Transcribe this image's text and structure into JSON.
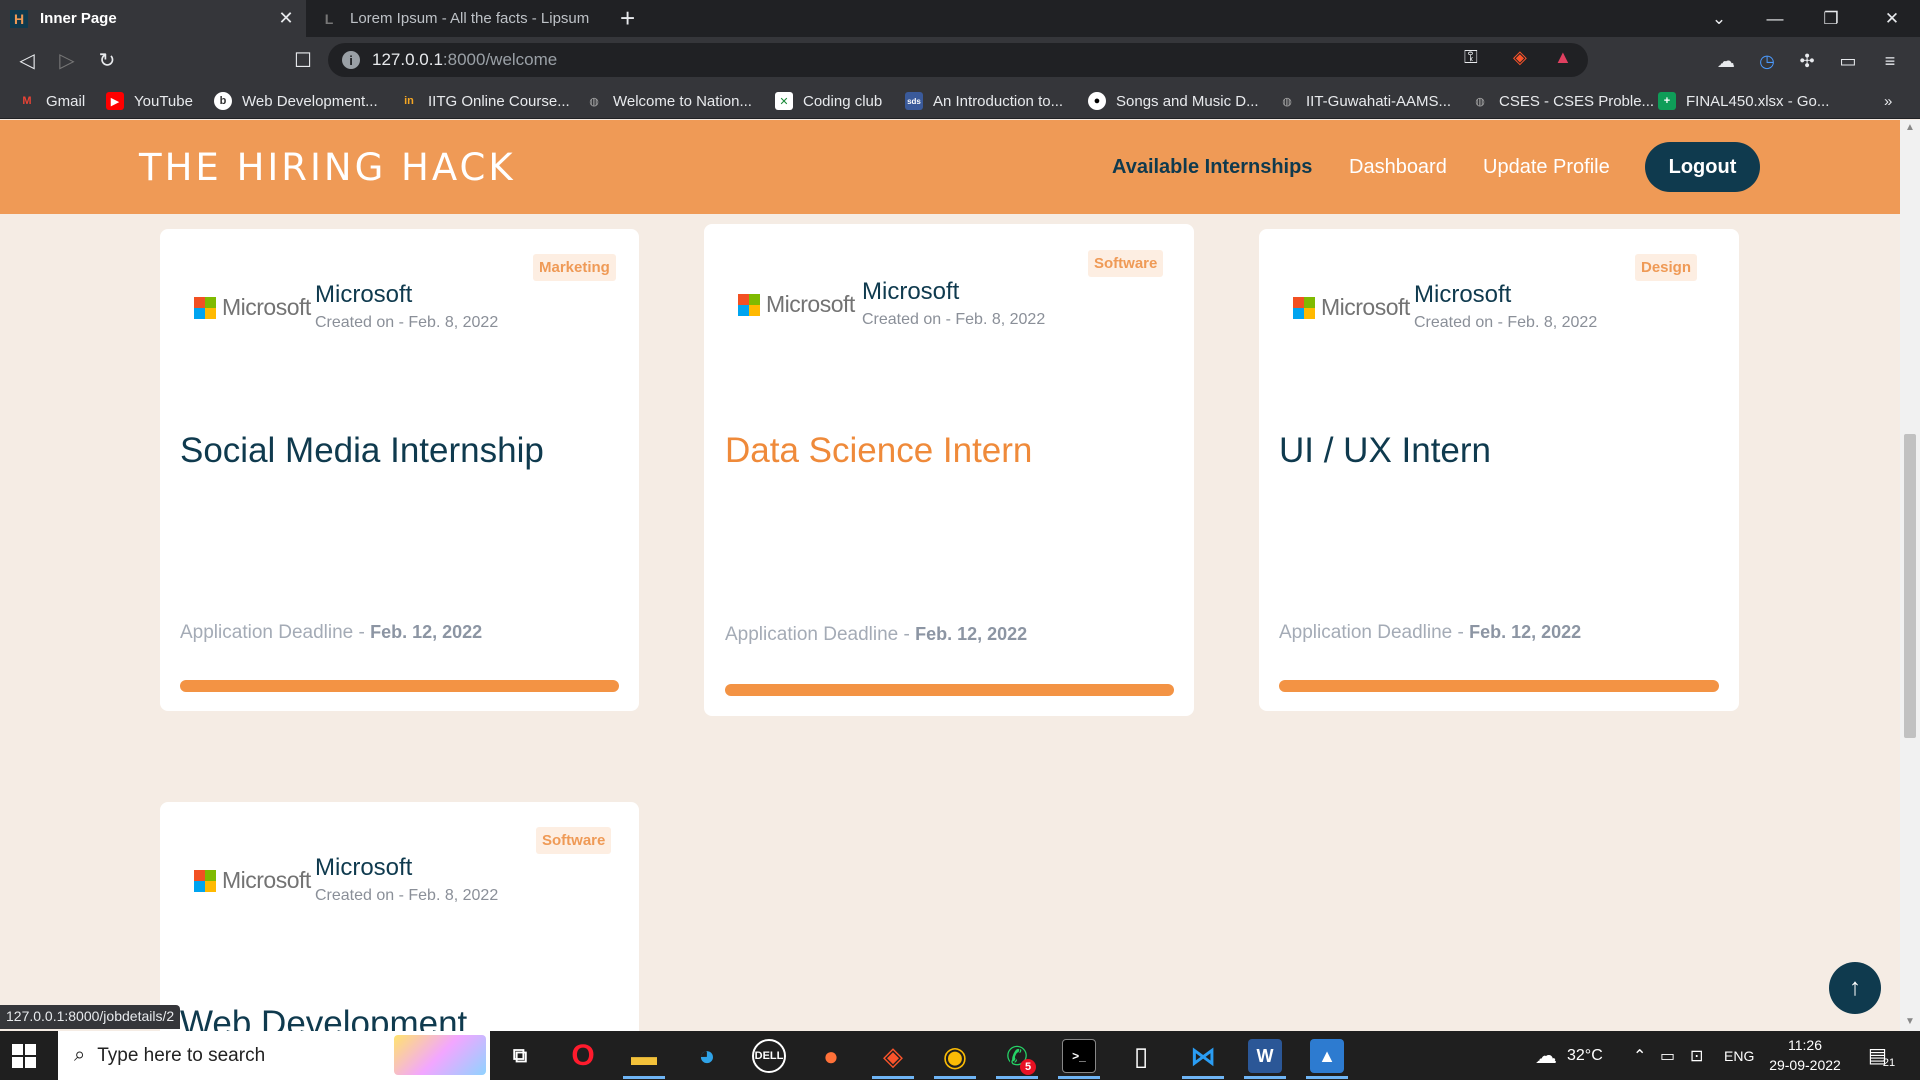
{
  "browser": {
    "tabs": [
      {
        "title": "Inner Page",
        "active": true
      },
      {
        "title": "Lorem Ipsum - All the facts - Lipsum g",
        "active": false
      }
    ],
    "url_host": "127.0.0.1",
    "url_path": ":8000/welcome",
    "bookmarks": [
      {
        "label": "Gmail",
        "icon": "gmail-icon"
      },
      {
        "label": "YouTube",
        "icon": "youtube-icon"
      },
      {
        "label": "Web Development...",
        "icon": "globe-icon"
      },
      {
        "label": "IITG Online Course...",
        "icon": "course-icon"
      },
      {
        "label": "Welcome to Nation...",
        "icon": "globe-icon"
      },
      {
        "label": "Coding club",
        "icon": "coding-club-icon"
      },
      {
        "label": "An Introduction to...",
        "icon": "document-icon"
      },
      {
        "label": "Songs and Music D...",
        "icon": "github-icon"
      },
      {
        "label": "IIT-Guwahati-AAMS...",
        "icon": "globe-icon"
      },
      {
        "label": "CSES - CSES Proble...",
        "icon": "globe-icon"
      },
      {
        "label": "FINAL450.xlsx - Go...",
        "icon": "sheets-icon"
      }
    ],
    "status_link": "127.0.0.1:8000/jobdetails/2"
  },
  "site": {
    "brand": "THE HIRING HACK",
    "nav": [
      {
        "label": "Available Internships",
        "active": true
      },
      {
        "label": "Dashboard",
        "active": false
      },
      {
        "label": "Update Profile",
        "active": false
      }
    ],
    "logout_label": "Logout"
  },
  "logo_text": "Microsoft",
  "deadline_label": "Application Deadline - ",
  "cards": [
    {
      "company": "Microsoft",
      "created": "Created on - Feb. 8, 2022",
      "tag": "Marketing",
      "title": "Social Media Internship",
      "deadline": "Feb. 12, 2022"
    },
    {
      "company": "Microsoft",
      "created": "Created on - Feb. 8, 2022",
      "tag": "Software",
      "title": "Data Science Intern",
      "deadline": "Feb. 12, 2022"
    },
    {
      "company": "Microsoft",
      "created": "Created on - Feb. 8, 2022",
      "tag": "Design",
      "title": "UI / UX Intern",
      "deadline": "Feb. 12, 2022"
    },
    {
      "company": "Microsoft",
      "created": "Created on - Feb. 8, 2022",
      "tag": "Software",
      "title": "Web Development"
    }
  ],
  "taskbar": {
    "search_placeholder": "Type here to search",
    "weather": "32°C",
    "language": "ENG",
    "time": "11:26",
    "date": "29-09-2022",
    "whatsapp_badge": "5",
    "notification_count": "21"
  },
  "colors": {
    "header_bg": "#ef9a56",
    "accent_dark": "#0f3a4e",
    "accent_orange": "#f39344",
    "page_bg": "#f5ece4"
  }
}
